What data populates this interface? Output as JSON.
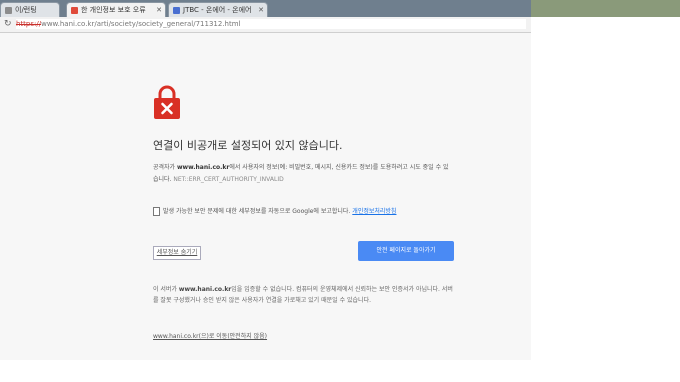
{
  "tabs": [
    {
      "label": "이/런팅",
      "active": false
    },
    {
      "label": "한 개인정보 보호 오류",
      "active": true
    },
    {
      "label": "JTBC - 온에어 - 온에어",
      "active": false
    }
  ],
  "address": {
    "scheme": "https://",
    "rest": "www.hani.co.kr/arti/society/society_general/711312.html"
  },
  "interstitial": {
    "title": "연결이 비공개로 설정되어 있지 않습니다.",
    "desc_prefix": "공격자가 ",
    "domain": "www.hani.co.kr",
    "desc_suffix": "에서 사용자의 정보(예: 비밀번호, 메시지, 신용카드 정보)를 도용하려고 시도 중일 수 있습니다.",
    "error_code": "NET::ERR_CERT_AUTHORITY_INVALID",
    "report_text": "발생 가능한 보안 문제에 대한 세부정보를 자동으로 Google에 보고합니다.",
    "report_link": "개인정보처리방침",
    "advanced_button": "세부정보 숨기기",
    "back_button": "안전 페이지로 돌아가기",
    "details_prefix": "이 서버가 ",
    "details_domain": "www.hani.co.kr",
    "details_suffix": "임을 입증할 수 없습니다. 컴퓨터의 운영체제에서 신뢰하는 보안 인증서가 아닙니다. 서버를 잘못 구성했거나 승인 받지 않은 사용자가 연결을 가로채고 있기 때문일 수 있습니다.",
    "proceed_link": "www.hani.co.kr(으)로 이동(안전하지 않음)"
  },
  "colors": {
    "lock": "#d93025",
    "primary_button": "#4a8af4",
    "tabbar": "#6f7f8e"
  },
  "icons": {
    "lock": "lock-icon",
    "reload": "reload-icon",
    "close": "close-icon"
  }
}
